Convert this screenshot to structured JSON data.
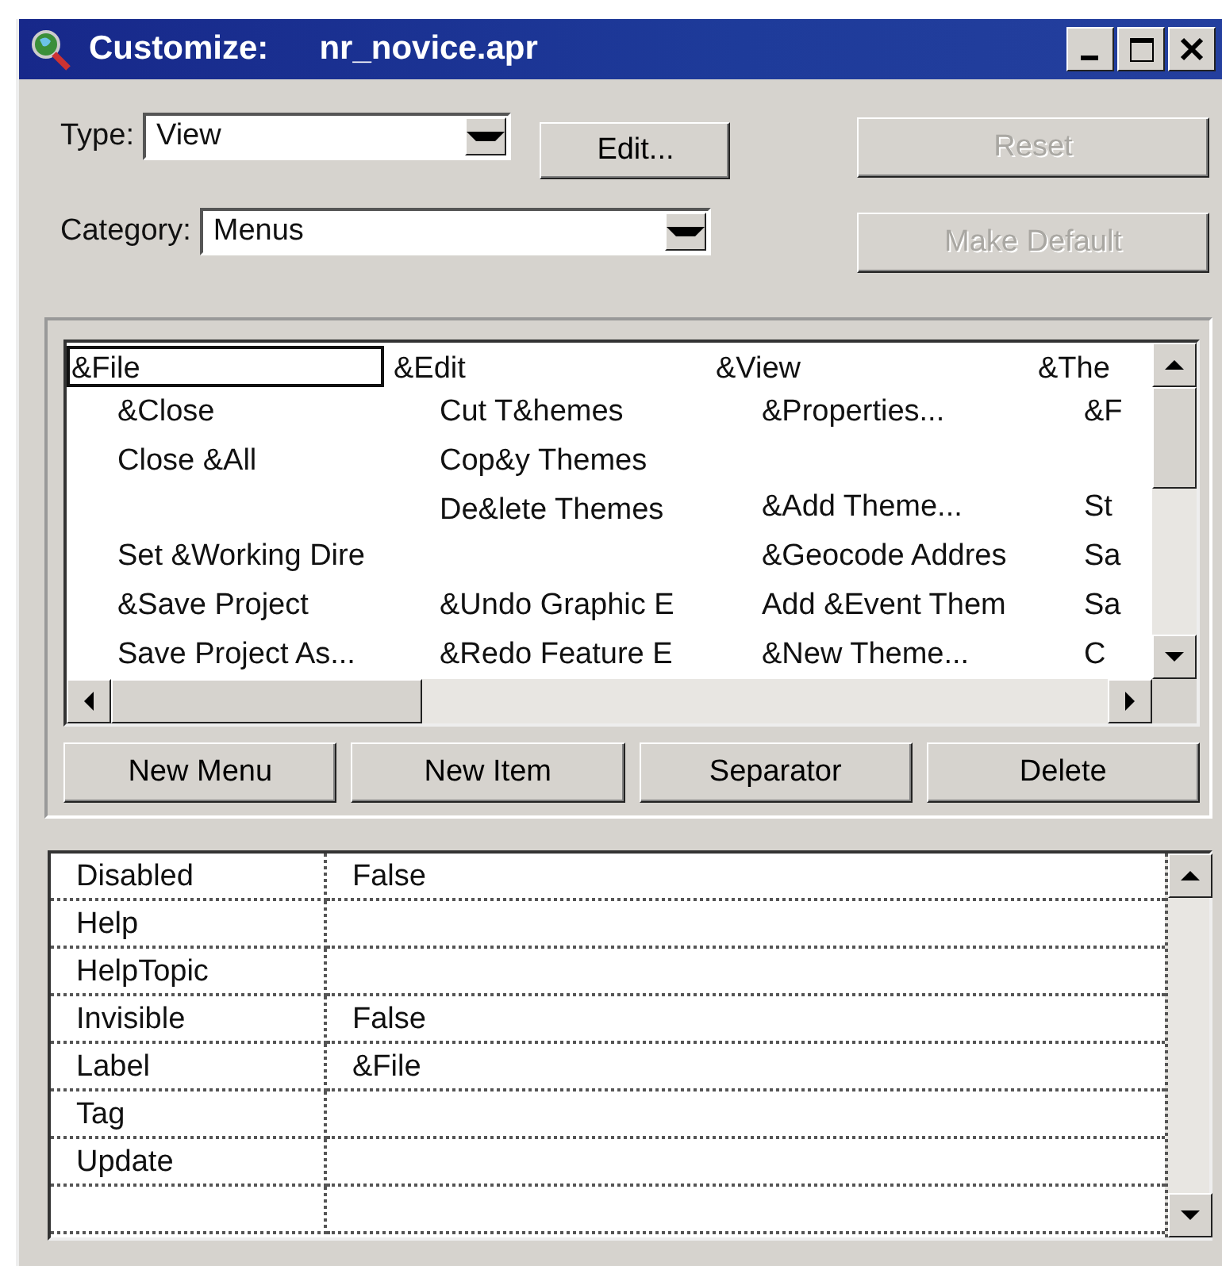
{
  "window": {
    "title": "Customize:",
    "document": "nr_novice.apr"
  },
  "type_field": {
    "label": "Type:",
    "value": "View"
  },
  "category_field": {
    "label": "Category:",
    "value": "Menus"
  },
  "buttons": [
    {
      "label": "Edit...",
      "disabled": false
    },
    {
      "label": "Reset",
      "disabled": true
    },
    {
      "label": "Make Default",
      "disabled": true
    }
  ],
  "menus": [
    {
      "label": "&File",
      "selected": true,
      "items": [
        {
          "kind": "item",
          "text": "&Close"
        },
        {
          "kind": "item",
          "text": "Close &All"
        },
        {
          "kind": "separator"
        },
        {
          "kind": "item",
          "text": "Set &Working Dire"
        },
        {
          "kind": "item",
          "text": "&Save Project"
        },
        {
          "kind": "item",
          "text": "Save Project As..."
        }
      ]
    },
    {
      "label": "&Edit",
      "selected": false,
      "items": [
        {
          "kind": "item",
          "text": "Cut T&hemes"
        },
        {
          "kind": "item",
          "text": "Cop&y Themes"
        },
        {
          "kind": "item",
          "text": "De&lete Themes"
        },
        {
          "kind": "separator"
        },
        {
          "kind": "item",
          "text": "&Undo Graphic E"
        },
        {
          "kind": "item",
          "text": "&Redo Feature E"
        }
      ]
    },
    {
      "label": "&View",
      "selected": false,
      "items": [
        {
          "kind": "item",
          "text": "&Properties..."
        },
        {
          "kind": "separator"
        },
        {
          "kind": "item",
          "text": "&Add Theme..."
        },
        {
          "kind": "item",
          "text": "&Geocode Addres"
        },
        {
          "kind": "item",
          "text": "Add &Event Them"
        },
        {
          "kind": "item",
          "text": "&New Theme..."
        }
      ]
    },
    {
      "label": "&The",
      "selected": false,
      "items": [
        {
          "kind": "item",
          "text": "&F"
        },
        {
          "kind": "separator"
        },
        {
          "kind": "item",
          "text": "St"
        },
        {
          "kind": "item",
          "text": "Sa"
        },
        {
          "kind": "item",
          "text": "Sa"
        },
        {
          "kind": "item",
          "text": "C"
        }
      ]
    }
  ],
  "menu_buttons": [
    "New Menu",
    "New Item",
    "Separator",
    "Delete"
  ],
  "properties": [
    {
      "name": "Disabled",
      "value": "False"
    },
    {
      "name": "Help"
    },
    {
      "name": "HelpTopic"
    },
    {
      "name": "Invisible",
      "value": "False"
    },
    {
      "name": "Label",
      "value": "&File"
    },
    {
      "name": "Tag"
    },
    {
      "name": "Update"
    }
  ]
}
